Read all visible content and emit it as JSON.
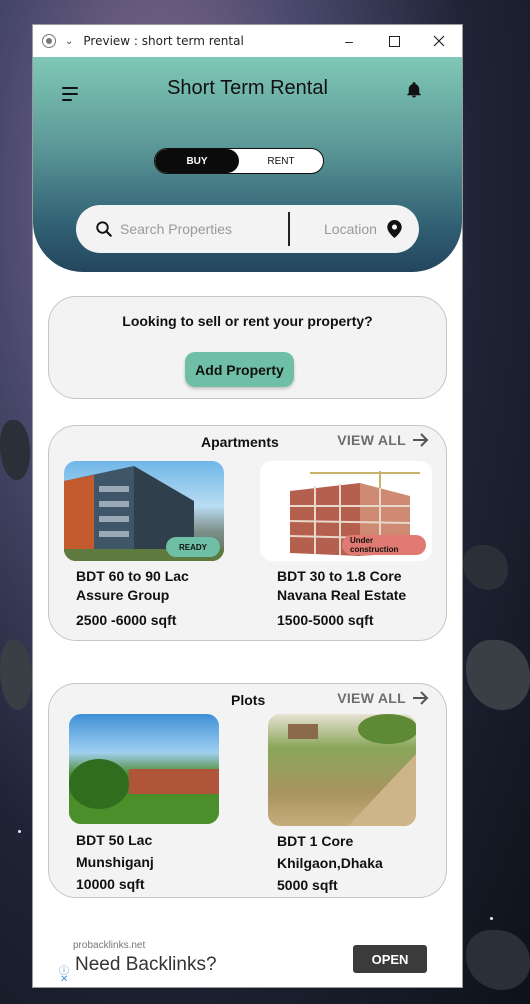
{
  "window": {
    "title": "Preview : short term rental"
  },
  "header": {
    "app_title": "Short Term Rental",
    "toggle": {
      "buy": "BUY",
      "rent": "RENT",
      "selected": "BUY"
    },
    "search": {
      "placeholder": "Search Properties",
      "location_label": "Location"
    }
  },
  "sell_card": {
    "text": "Looking to sell or rent your property?",
    "button": "Add Property"
  },
  "apartments": {
    "title": "Apartments",
    "view_all": "VIEW ALL",
    "items": [
      {
        "price": "BDT  60 to 90 Lac",
        "developer": "Assure Group",
        "size": "2500 -6000 sqft",
        "badge": "READY"
      },
      {
        "price": "BDT  30 to 1.8 Core",
        "developer": "Navana Real Estate",
        "size": "1500-5000 sqft",
        "badge": "Under construction"
      }
    ]
  },
  "plots": {
    "title": "Plots",
    "view_all": "VIEW ALL",
    "items": [
      {
        "price": "BDT 50 Lac",
        "location": "Munshiganj",
        "size": "10000 sqft"
      },
      {
        "price": "BDT 1 Core",
        "location": "Khilgaon,Dhaka",
        "size": "5000 sqft"
      }
    ]
  },
  "ad": {
    "url": "probacklinks.net",
    "headline": "Need Backlinks?",
    "button": "OPEN"
  },
  "colors": {
    "accent_green": "#6fbfa6",
    "badge_red": "#e07a72",
    "header_top": "#7fc8b6",
    "header_bottom": "#24465f"
  }
}
